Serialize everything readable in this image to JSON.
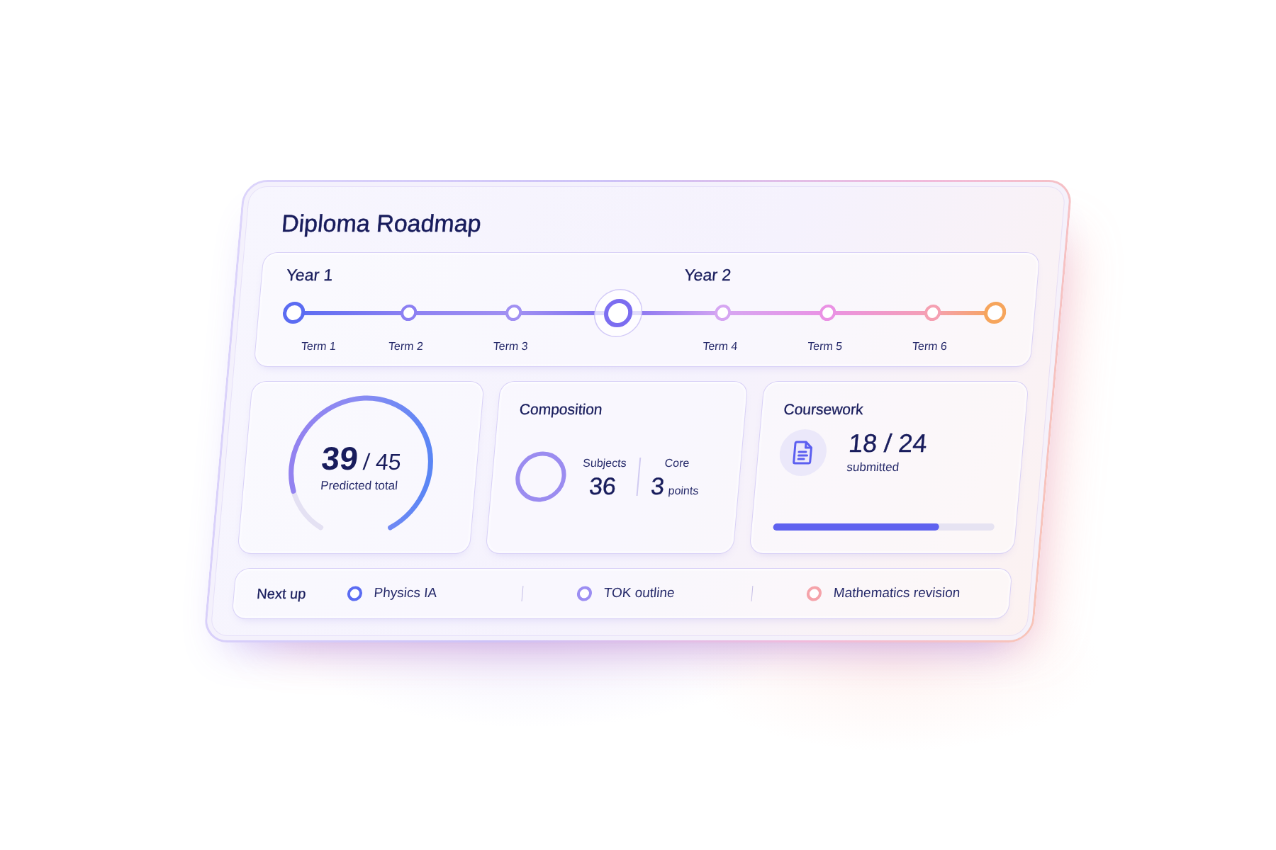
{
  "title": "Diploma Roadmap",
  "timeline": {
    "nodes": [
      {
        "kind": "endpoint",
        "year": "Year 1",
        "label": "Term 1",
        "color": "#5b6cf2"
      },
      {
        "kind": "term",
        "label": "Term 2",
        "color": "#8c80f2"
      },
      {
        "kind": "term",
        "label": "Term 3",
        "color": "#a190f2"
      },
      {
        "kind": "current",
        "year": "Year 2",
        "color": "#7b6df0"
      },
      {
        "kind": "term",
        "label": "Term 4",
        "color": "#d6a6f2"
      },
      {
        "kind": "term",
        "label": "Term 5",
        "color": "#ea92e4"
      },
      {
        "kind": "term",
        "label": "Term 6",
        "color": "#f5a0b2"
      },
      {
        "kind": "endpoint",
        "color": "#f6a55c"
      }
    ]
  },
  "predicted": {
    "score": "39",
    "out_of": "/ 45",
    "label": "Predicted total"
  },
  "composition": {
    "title": "Composition",
    "stats": [
      {
        "label": "Subjects",
        "value": "36"
      },
      {
        "label": "Core",
        "value": "3",
        "unit": "points"
      }
    ]
  },
  "coursework": {
    "title": "Coursework",
    "count": "18 / 24",
    "label": "submitted",
    "level": 0.75
  },
  "next_up": {
    "label": "Next up",
    "items": [
      {
        "label": "Physics IA",
        "color": "#5b6cf2"
      },
      {
        "label": "TOK outline",
        "color": "#9c8ef2"
      },
      {
        "label": "Mathematics revision",
        "color": "#f5a3aa"
      }
    ]
  }
}
